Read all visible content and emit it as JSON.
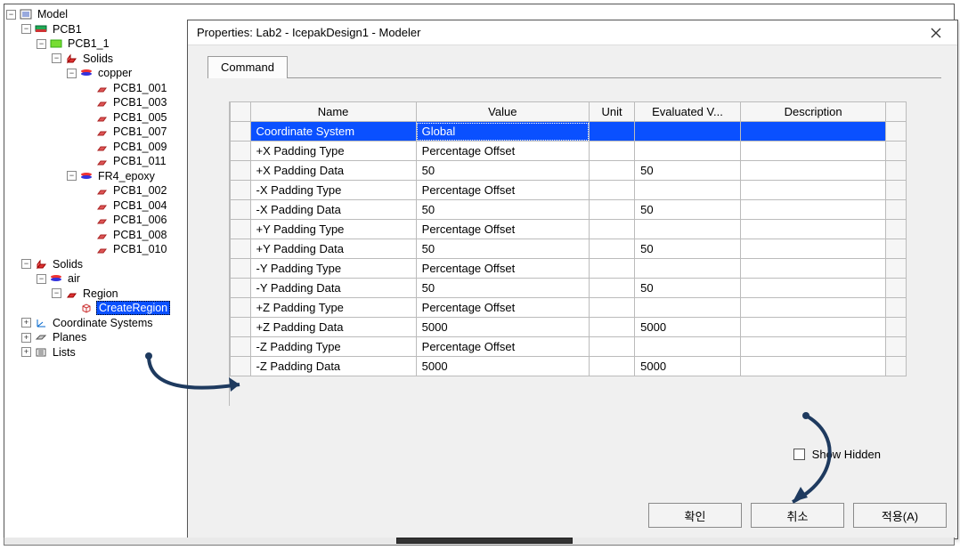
{
  "tree": {
    "root": "Model",
    "pcb1": "PCB1",
    "pcb1_1": "PCB1_1",
    "solids1": "Solids",
    "copper": "copper",
    "cop_items": [
      "PCB1_001",
      "PCB1_003",
      "PCB1_005",
      "PCB1_007",
      "PCB1_009",
      "PCB1_011"
    ],
    "fr4": "FR4_epoxy",
    "fr4_items": [
      "PCB1_002",
      "PCB1_004",
      "PCB1_006",
      "PCB1_008",
      "PCB1_010"
    ],
    "solids2": "Solids",
    "air": "air",
    "region": "Region",
    "createregion": "CreateRegion",
    "coord": "Coordinate Systems",
    "planes": "Planes",
    "lists": "Lists"
  },
  "dialog": {
    "title": "Properties: Lab2 - IcepakDesign1 - Modeler",
    "tab": "Command",
    "columns": {
      "name": "Name",
      "value": "Value",
      "unit": "Unit",
      "eval": "Evaluated V...",
      "desc": "Description"
    },
    "rows": [
      {
        "name": "Coordinate System",
        "value": "Global",
        "unit": "",
        "eval": "",
        "desc": "",
        "selected": true
      },
      {
        "name": "+X Padding Type",
        "value": "Percentage Offset",
        "unit": "",
        "eval": "",
        "desc": ""
      },
      {
        "name": "+X Padding Data",
        "value": "50",
        "unit": "",
        "eval": "50",
        "desc": ""
      },
      {
        "name": "-X Padding Type",
        "value": "Percentage Offset",
        "unit": "",
        "eval": "",
        "desc": ""
      },
      {
        "name": "-X Padding Data",
        "value": "50",
        "unit": "",
        "eval": "50",
        "desc": ""
      },
      {
        "name": "+Y Padding Type",
        "value": "Percentage Offset",
        "unit": "",
        "eval": "",
        "desc": ""
      },
      {
        "name": "+Y Padding Data",
        "value": "50",
        "unit": "",
        "eval": "50",
        "desc": ""
      },
      {
        "name": "-Y Padding Type",
        "value": "Percentage Offset",
        "unit": "",
        "eval": "",
        "desc": ""
      },
      {
        "name": "-Y Padding Data",
        "value": "50",
        "unit": "",
        "eval": "50",
        "desc": ""
      },
      {
        "name": "+Z Padding Type",
        "value": "Percentage Offset",
        "unit": "",
        "eval": "",
        "desc": ""
      },
      {
        "name": "+Z Padding Data",
        "value": "5000",
        "unit": "",
        "eval": "5000",
        "desc": ""
      },
      {
        "name": "-Z Padding Type",
        "value": "Percentage Offset",
        "unit": "",
        "eval": "",
        "desc": ""
      },
      {
        "name": "-Z Padding Data",
        "value": "5000",
        "unit": "",
        "eval": "5000",
        "desc": ""
      }
    ],
    "show_hidden": "Show Hidden",
    "buttons": {
      "ok": "확인",
      "cancel": "취소",
      "apply": "적용(A)"
    }
  }
}
